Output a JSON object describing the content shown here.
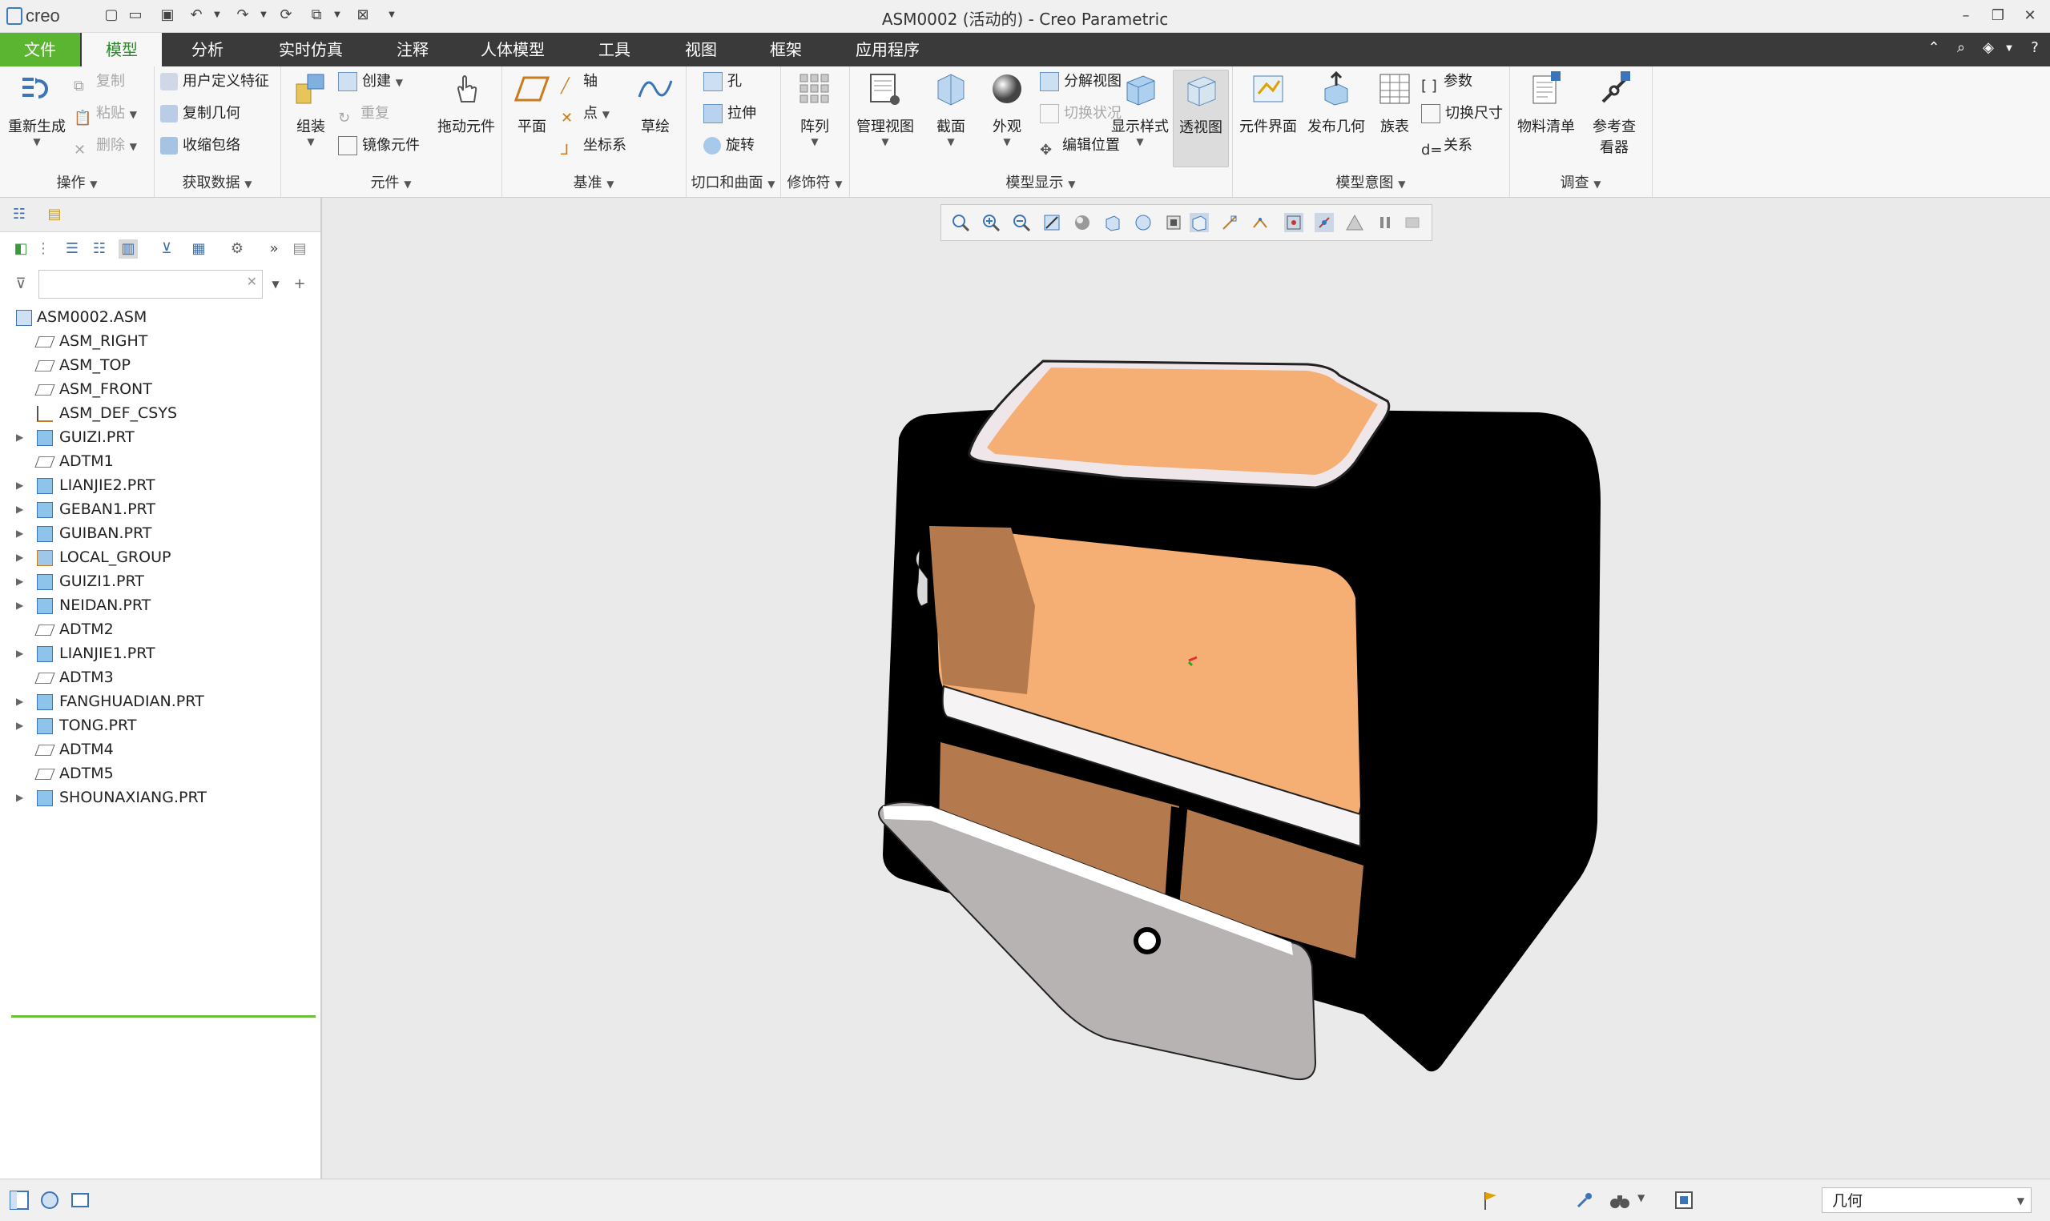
{
  "app": {
    "logo": "creo",
    "window_title": "ASM0002 (活动的) - Creo Parametric"
  },
  "tabs": [
    "文件",
    "模型",
    "分析",
    "实时仿真",
    "注释",
    "人体模型",
    "工具",
    "视图",
    "框架",
    "应用程序"
  ],
  "ribbon": {
    "ops": {
      "regen": "重新生成",
      "copy": "复制",
      "paste": "粘贴",
      "delete": "删除",
      "label": "操作"
    },
    "getdata": {
      "udf": "用户定义特征",
      "copygeom": "复制几何",
      "shrinkwrap": "收缩包络",
      "label": "获取数据"
    },
    "comp": {
      "assemble": "组装",
      "create": "创建",
      "repeat": "重复",
      "mirror": "镜像元件",
      "drag": "拖动元件",
      "label": "元件"
    },
    "datum": {
      "plane": "平面",
      "axis": "轴",
      "point": "点",
      "csys": "坐标系",
      "sketch": "草绘",
      "label": "基准"
    },
    "cut": {
      "hole": "孔",
      "extrude": "拉伸",
      "revolve": "旋转",
      "label": "切口和曲面"
    },
    "mod": {
      "pattern": "阵列",
      "label": "修饰符"
    },
    "display": {
      "manageview": "管理视图",
      "section": "截面",
      "appearance": "外观",
      "explode": "分解视图",
      "togglestatus": "切换状况",
      "editpos": "编辑位置",
      "style": "显示样式",
      "transparent": "透视图",
      "label": "模型显示"
    },
    "intent": {
      "interface": "元件界面",
      "publish": "发布几何",
      "family": "族表",
      "params": "参数",
      "dims": "切换尺寸",
      "relations": "关系",
      "label": "模型意图"
    },
    "investigate": {
      "bom": "物料清单",
      "refviewer": "参考查看器",
      "label": "调查"
    }
  },
  "tree": [
    {
      "label": "ASM0002.ASM",
      "icon": "assembly-icon",
      "expandable": false
    },
    {
      "label": "ASM_RIGHT",
      "icon": "datum-plane-icon",
      "expandable": false
    },
    {
      "label": "ASM_TOP",
      "icon": "datum-plane-icon",
      "expandable": false
    },
    {
      "label": "ASM_FRONT",
      "icon": "datum-plane-icon",
      "expandable": false
    },
    {
      "label": "ASM_DEF_CSYS",
      "icon": "csys-icon",
      "expandable": false
    },
    {
      "label": "GUIZI.PRT",
      "icon": "part-icon",
      "expandable": true
    },
    {
      "label": "ADTM1",
      "icon": "datum-plane-icon",
      "expandable": false
    },
    {
      "label": "LIANJIE2.PRT",
      "icon": "part-icon",
      "expandable": true
    },
    {
      "label": "GEBAN1.PRT",
      "icon": "part-icon",
      "expandable": true
    },
    {
      "label": "GUIBAN.PRT",
      "icon": "part-icon",
      "expandable": true
    },
    {
      "label": "LOCAL_GROUP",
      "icon": "group-icon",
      "expandable": true
    },
    {
      "label": "GUIZI1.PRT",
      "icon": "part-icon",
      "expandable": true
    },
    {
      "label": "NEIDAN.PRT",
      "icon": "part-icon",
      "expandable": true
    },
    {
      "label": "ADTM2",
      "icon": "datum-plane-icon",
      "expandable": false
    },
    {
      "label": "LIANJIE1.PRT",
      "icon": "part-icon",
      "expandable": true
    },
    {
      "label": "ADTM3",
      "icon": "datum-plane-icon",
      "expandable": false
    },
    {
      "label": "FANGHUADIAN.PRT",
      "icon": "part-icon",
      "expandable": true
    },
    {
      "label": "TONG.PRT",
      "icon": "part-icon",
      "expandable": true
    },
    {
      "label": "ADTM4",
      "icon": "datum-plane-icon",
      "expandable": false
    },
    {
      "label": "ADTM5",
      "icon": "datum-plane-icon",
      "expandable": false
    },
    {
      "label": "SHOUNAXIANG.PRT",
      "icon": "part-icon",
      "expandable": true
    }
  ],
  "status": {
    "filter_value": "几何"
  },
  "colors": {
    "file_tab": "#5cb531",
    "tab_bar": "#3a3a3a",
    "active_tab_text": "#2a8a2a",
    "model_orange": "#f5ae73",
    "model_black": "#000000"
  }
}
